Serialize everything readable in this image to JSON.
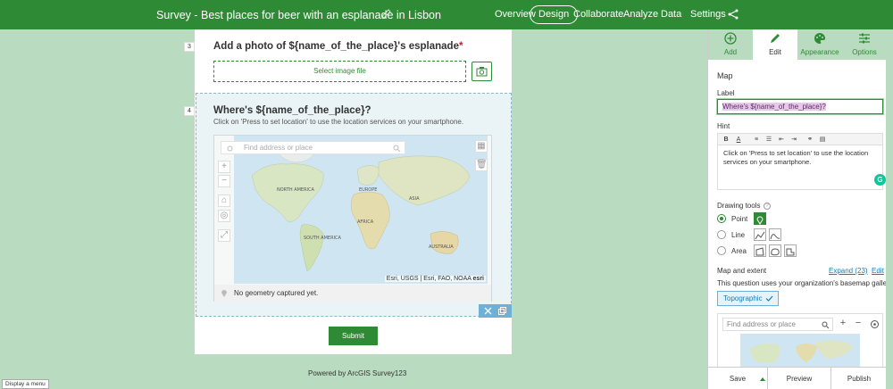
{
  "header": {
    "title": "Survey - Best places for beer with an esplanade in Lisbon",
    "nav": [
      "Overview",
      "Design",
      "Collaborate",
      "Analyze",
      "Data",
      "Settings"
    ],
    "active_nav": "Design"
  },
  "form": {
    "q3": {
      "number": "3",
      "title": "Add a photo of ${name_of_the_place}'s esplanade",
      "required_mark": "*",
      "select_label": "Select image file"
    },
    "q4": {
      "number": "4",
      "title": "Where's ${name_of_the_place}?",
      "hint": "Click on 'Press to set location' to use the location services on your smartphone.",
      "search_placeholder": "Find address or place",
      "attribution": "Esri, USGS | Esri, FAO, NOAA",
      "esri_logo": "esri",
      "no_geometry": "No geometry captured yet.",
      "map_labels": [
        "NORTH AMERICA",
        "EUROPE",
        "ASIA",
        "AFRICA",
        "SOUTH AMERICA",
        "AUSTRALIA"
      ]
    },
    "submit_label": "Submit",
    "powered_by": "Powered by ArcGIS Survey123",
    "tooltip": "Display a menu"
  },
  "panel": {
    "tabs": [
      {
        "label": "Add",
        "icon": "plus-circle-icon"
      },
      {
        "label": "Edit",
        "icon": "pencil-icon"
      },
      {
        "label": "Appearance",
        "icon": "palette-icon"
      },
      {
        "label": "Options",
        "icon": "sliders-icon"
      }
    ],
    "active_tab": "Edit",
    "section_title": "Map",
    "label_caption": "Label",
    "label_value": "Where's ${name_of_the_place}?",
    "hint_caption": "Hint",
    "hint_value": "Click on 'Press to set location' to use the location services on your smartphone.",
    "drawing_tools_caption": "Drawing tools",
    "drawing_tools": [
      {
        "label": "Point",
        "selected": true
      },
      {
        "label": "Line",
        "selected": false
      },
      {
        "label": "Area",
        "selected": false
      }
    ],
    "map_extent_caption": "Map and extent",
    "expand_link": "Expand (23)",
    "edit_link": "Edit",
    "basemap_note": "This question uses your organization's basemap gallery",
    "basemap_selected": "Topographic",
    "mini_search_placeholder": "Find address or place",
    "footer": {
      "save": "Save",
      "preview": "Preview",
      "publish": "Publish"
    }
  },
  "colors": {
    "brand": "#2f8a36",
    "background": "#b9dcc0",
    "link": "#1a7bb8",
    "required": "#c21f24"
  }
}
